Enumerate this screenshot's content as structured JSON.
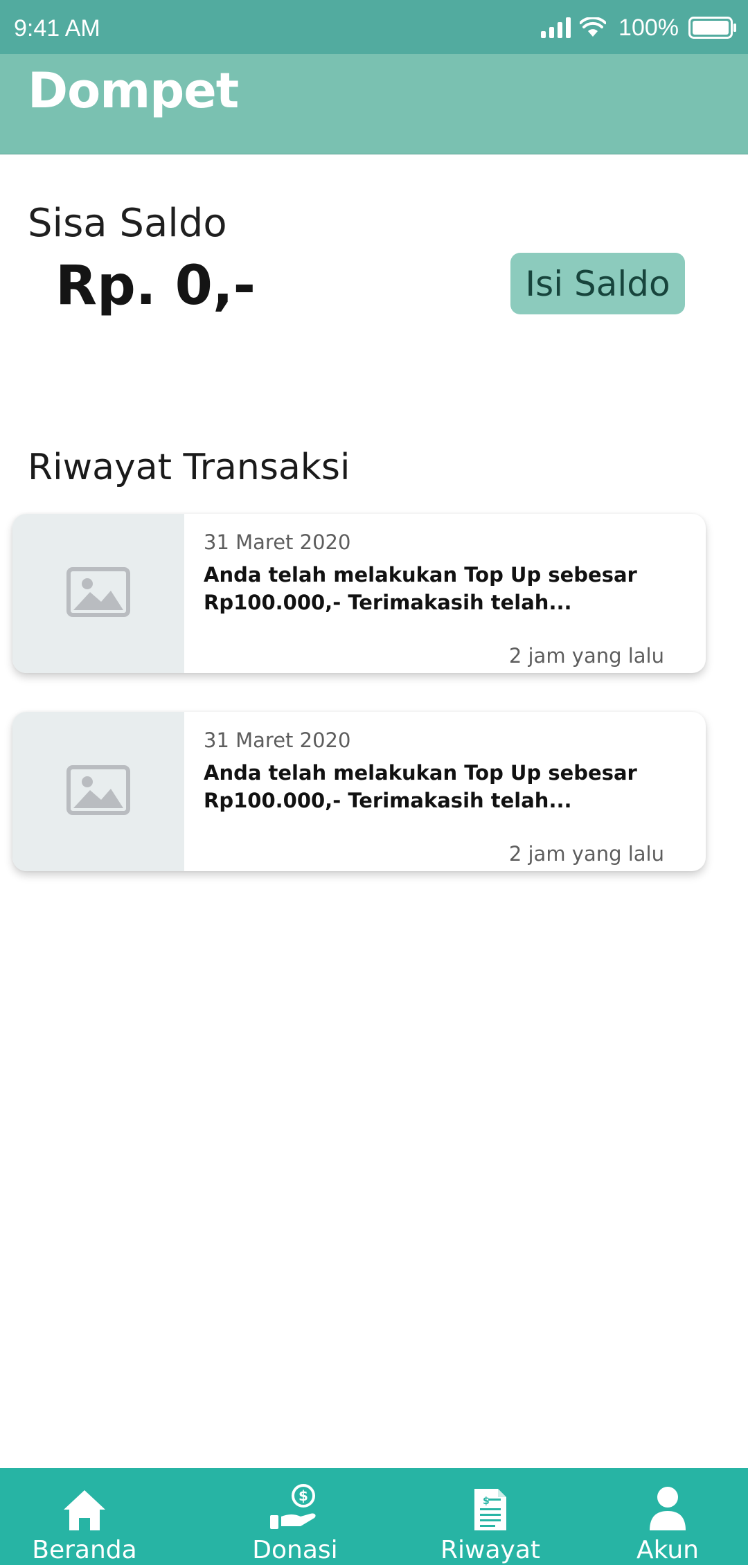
{
  "status_bar": {
    "time": "9:41 AM",
    "battery": "100%",
    "icons": [
      "signal-icon",
      "wifi-icon",
      "battery-icon"
    ]
  },
  "header": {
    "title": "Dompet"
  },
  "balance": {
    "label": "Sisa Saldo",
    "amount": "Rp. 0,-",
    "topup_label": "Isi Saldo"
  },
  "history": {
    "title": "Riwayat Transaksi",
    "items": [
      {
        "date": "31 Maret 2020",
        "description": "Anda telah melakukan Top Up sebesar Rp100.000,- Terimakasih telah...",
        "time": "2 jam yang lalu",
        "icon": "image-placeholder-icon"
      },
      {
        "date": "31 Maret 2020",
        "description": "Anda telah melakukan Top Up sebesar Rp100.000,- Terimakasih telah...",
        "time": "2 jam yang lalu",
        "icon": "image-placeholder-icon"
      }
    ]
  },
  "nav": {
    "items": [
      {
        "label": "Beranda",
        "icon": "home-icon"
      },
      {
        "label": "Donasi",
        "icon": "donation-hand-icon"
      },
      {
        "label": "Riwayat",
        "icon": "document-icon"
      },
      {
        "label": "Akun",
        "icon": "user-icon"
      }
    ]
  },
  "colors": {
    "status_bar": "#52ab9f",
    "header": "#7ac1b1",
    "button": "#8ccbbd",
    "nav": "#27b4a4"
  }
}
